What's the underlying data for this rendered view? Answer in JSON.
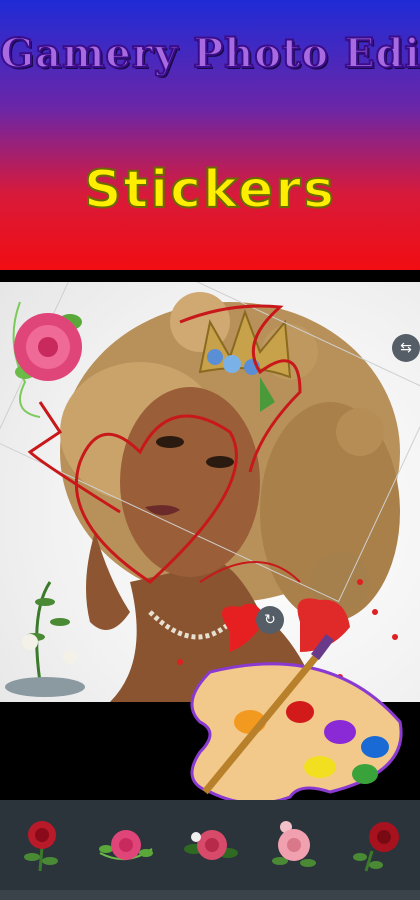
{
  "header": {
    "title": "Gamery Photo Editor",
    "subtitle": "Stickers"
  },
  "canvas": {
    "flip_icon": "flip-icon",
    "rotate_icon": "rotate-icon"
  },
  "sticker_bar": {
    "items": [
      "rose-red",
      "rose-pink-frame",
      "rose-bouquet",
      "rose-pink-blossom",
      "rose-dark-red"
    ]
  },
  "colors": {
    "header_top": "#1f2bd6",
    "header_bottom": "#f10d12",
    "title": "#a86ae0",
    "subtitle": "#ffee00",
    "sticker_bar": "#2c343b"
  }
}
